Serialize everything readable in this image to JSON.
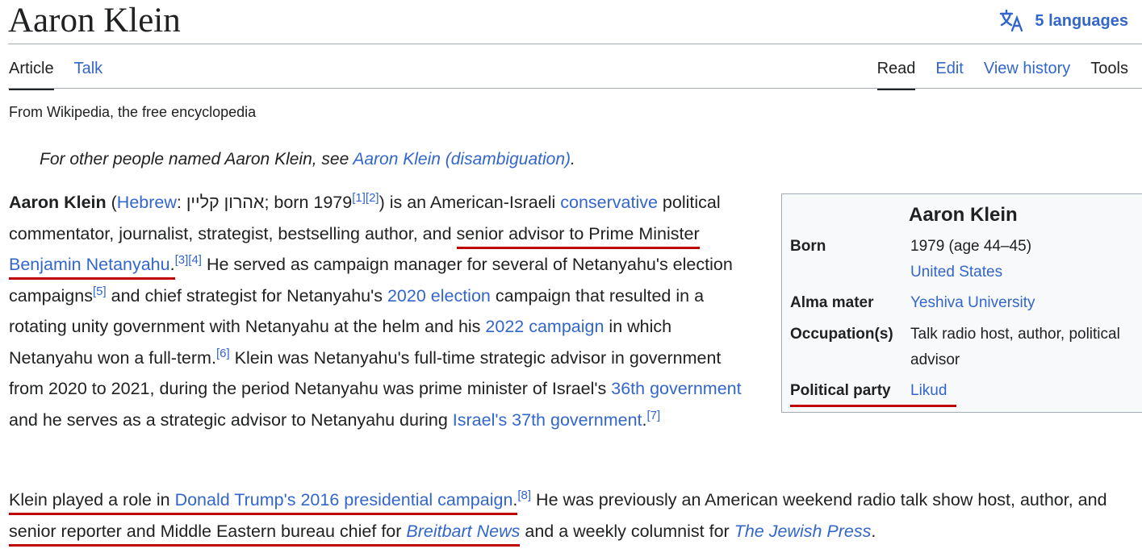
{
  "header": {
    "title": "Aaron Klein",
    "languages_label": "5 languages",
    "languages_icon": "translate-icon"
  },
  "tabs": {
    "article": "Article",
    "talk": "Talk",
    "read": "Read",
    "edit": "Edit",
    "view_history": "View history",
    "tools": "Tools"
  },
  "tagline": "From Wikipedia, the free encyclopedia",
  "hatnote": {
    "prefix": "For other people named Aaron Klein, see ",
    "link": "Aaron Klein (disambiguation)",
    "suffix": "."
  },
  "lead": {
    "name": "Aaron Klein",
    "t1": " (",
    "hebrew_link": "Hebrew",
    "t2": ": אהרון קליין; born 1979",
    "ref1": "[1]",
    "ref2": "[2]",
    "t3": ") is an American-Israeli ",
    "conservative_link": "conservative",
    "t4": " political commentator, journalist, strategist, bestselling author, and ",
    "u1": "senior advisor to Prime Minister ",
    "netanyahu_link": "Benjamin Netanyahu",
    "t5": ".",
    "ref3": "[3]",
    "ref4": "[4]",
    "t6": " He served as campaign manager for several of Netanyahu's election campaigns",
    "ref5": "[5]",
    "t7": " and chief strategist for Netanyahu's ",
    "election2020_link": "2020 election",
    "t8": " campaign that resulted in a rotating unity government with Netanyahu at the helm and his ",
    "campaign2022_link": "2022 campaign",
    "t9": " in which Netanyahu won a full-term.",
    "ref6": "[6]",
    "t10": " Klein was Netanyahu's full-time strategic advisor in government from 2020 to 2021, during the period Netanyahu was prime minister of Israel's ",
    "gov36_link": "36th government",
    "t11": " and he serves as a strategic advisor to Netanyahu during ",
    "gov37_link": "Israel's 37th government",
    "t12": ".",
    "ref7": "[7]"
  },
  "para2": {
    "u1": "Klein played a role in ",
    "trump_link": "Donald Trump's 2016 presidential campaign",
    "t1": ".",
    "ref8": "[8]",
    "t2": " He was previously an American weekend radio talk show host, author, and ",
    "u2": "senior reporter and Middle Eastern bureau chief for ",
    "breitbart_link": "Breitbart News",
    "t3": " and a weekly columnist for ",
    "jewish_press_link": "The Jewish Press",
    "t4": "."
  },
  "infobox": {
    "title": "Aaron Klein",
    "born_label": "Born",
    "born_value": "1979 (age 44–45)",
    "born_place_link": "United States",
    "alma_label": "Alma mater",
    "alma_link": "Yeshiva University",
    "occupation_label": "Occupation(s)",
    "occupation_line1": "Talk radio host, author, political",
    "occupation_line2": "advisor",
    "party_label": "Political party",
    "party_link": "Likud"
  },
  "colors": {
    "link": "#3366cc",
    "text": "#202122",
    "underline_mark": "#c00000",
    "infobox_bg": "#f8f9fa"
  }
}
